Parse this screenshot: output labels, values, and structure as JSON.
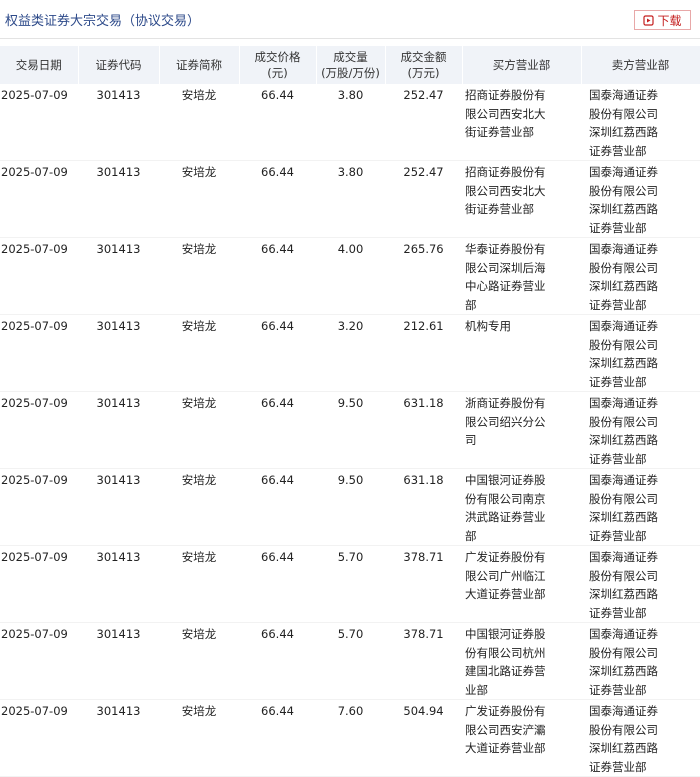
{
  "header": {
    "title": "权益类证券大宗交易（协议交易）",
    "download_label": "下载"
  },
  "table": {
    "columns": [
      {
        "key": "date",
        "line1": "交易日期",
        "line2": ""
      },
      {
        "key": "code",
        "line1": "证券代码",
        "line2": ""
      },
      {
        "key": "name",
        "line1": "证券简称",
        "line2": ""
      },
      {
        "key": "price",
        "line1": "成交价格",
        "line2": "(元)"
      },
      {
        "key": "volume",
        "line1": "成交量",
        "line2": "(万股/万份)"
      },
      {
        "key": "amount",
        "line1": "成交金额",
        "line2": "(万元)"
      },
      {
        "key": "buyer",
        "line1": "买方营业部",
        "line2": ""
      },
      {
        "key": "seller",
        "line1": "卖方营业部",
        "line2": ""
      }
    ],
    "rows": [
      {
        "date": "2025-07-09",
        "code": "301413",
        "name": "安培龙",
        "price": "66.44",
        "volume": "3.80",
        "amount": "252.47",
        "buyer": "招商证券股份有限公司西安北大街证券营业部",
        "seller": "国泰海通证券股份有限公司深圳红荔西路证券营业部"
      },
      {
        "date": "2025-07-09",
        "code": "301413",
        "name": "安培龙",
        "price": "66.44",
        "volume": "3.80",
        "amount": "252.47",
        "buyer": "招商证券股份有限公司西安北大街证券营业部",
        "seller": "国泰海通证券股份有限公司深圳红荔西路证券营业部"
      },
      {
        "date": "2025-07-09",
        "code": "301413",
        "name": "安培龙",
        "price": "66.44",
        "volume": "4.00",
        "amount": "265.76",
        "buyer": "华泰证券股份有限公司深圳后海中心路证券营业部",
        "seller": "国泰海通证券股份有限公司深圳红荔西路证券营业部"
      },
      {
        "date": "2025-07-09",
        "code": "301413",
        "name": "安培龙",
        "price": "66.44",
        "volume": "3.20",
        "amount": "212.61",
        "buyer": "机构专用",
        "seller": "国泰海通证券股份有限公司深圳红荔西路证券营业部"
      },
      {
        "date": "2025-07-09",
        "code": "301413",
        "name": "安培龙",
        "price": "66.44",
        "volume": "9.50",
        "amount": "631.18",
        "buyer": "浙商证券股份有限公司绍兴分公司",
        "seller": "国泰海通证券股份有限公司深圳红荔西路证券营业部"
      },
      {
        "date": "2025-07-09",
        "code": "301413",
        "name": "安培龙",
        "price": "66.44",
        "volume": "9.50",
        "amount": "631.18",
        "buyer": "中国银河证券股份有限公司南京洪武路证券营业部",
        "seller": "国泰海通证券股份有限公司深圳红荔西路证券营业部"
      },
      {
        "date": "2025-07-09",
        "code": "301413",
        "name": "安培龙",
        "price": "66.44",
        "volume": "5.70",
        "amount": "378.71",
        "buyer": "广发证券股份有限公司广州临江大道证券营业部",
        "seller": "国泰海通证券股份有限公司深圳红荔西路证券营业部"
      },
      {
        "date": "2025-07-09",
        "code": "301413",
        "name": "安培龙",
        "price": "66.44",
        "volume": "5.70",
        "amount": "378.71",
        "buyer": "中国银河证券股份有限公司杭州建国北路证券营业部",
        "seller": "国泰海通证券股份有限公司深圳红荔西路证券营业部"
      },
      {
        "date": "2025-07-09",
        "code": "301413",
        "name": "安培龙",
        "price": "66.44",
        "volume": "7.60",
        "amount": "504.94",
        "buyer": "广发证券股份有限公司西安浐灞大道证券营业部",
        "seller": "国泰海通证券股份有限公司深圳红荔西路证券营业部"
      }
    ]
  }
}
